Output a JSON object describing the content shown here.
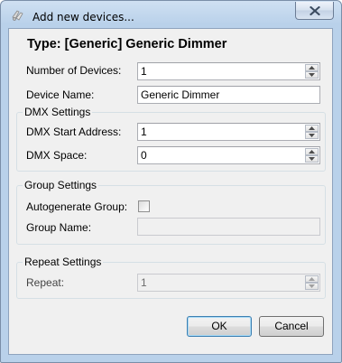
{
  "window": {
    "title": "Add new devices...",
    "icon": "devices-app-icon",
    "close_icon": "close-icon"
  },
  "heading": "Type: [Generic] Generic Dimmer",
  "fields": {
    "number_of_devices": {
      "label": "Number of Devices:",
      "value": "1"
    },
    "device_name": {
      "label": "Device Name:",
      "value": "Generic Dimmer"
    }
  },
  "dmx_settings": {
    "title": "DMX Settings",
    "start_address": {
      "label": "DMX Start Address:",
      "value": "1"
    },
    "space": {
      "label": "DMX Space:",
      "value": "0"
    }
  },
  "group_settings": {
    "title": "Group Settings",
    "autogenerate": {
      "label": "Autogenerate Group:",
      "checked": false
    },
    "group_name": {
      "label": "Group Name:",
      "value": ""
    }
  },
  "repeat_settings": {
    "title": "Repeat Settings",
    "repeat": {
      "label": "Repeat:",
      "value": "1"
    }
  },
  "buttons": {
    "ok": "OK",
    "cancel": "Cancel"
  },
  "colors": {
    "title_bar": "#b9d1ea",
    "dialog_background": "#f0f0f0",
    "default_button_border": "#3c7fb1"
  }
}
